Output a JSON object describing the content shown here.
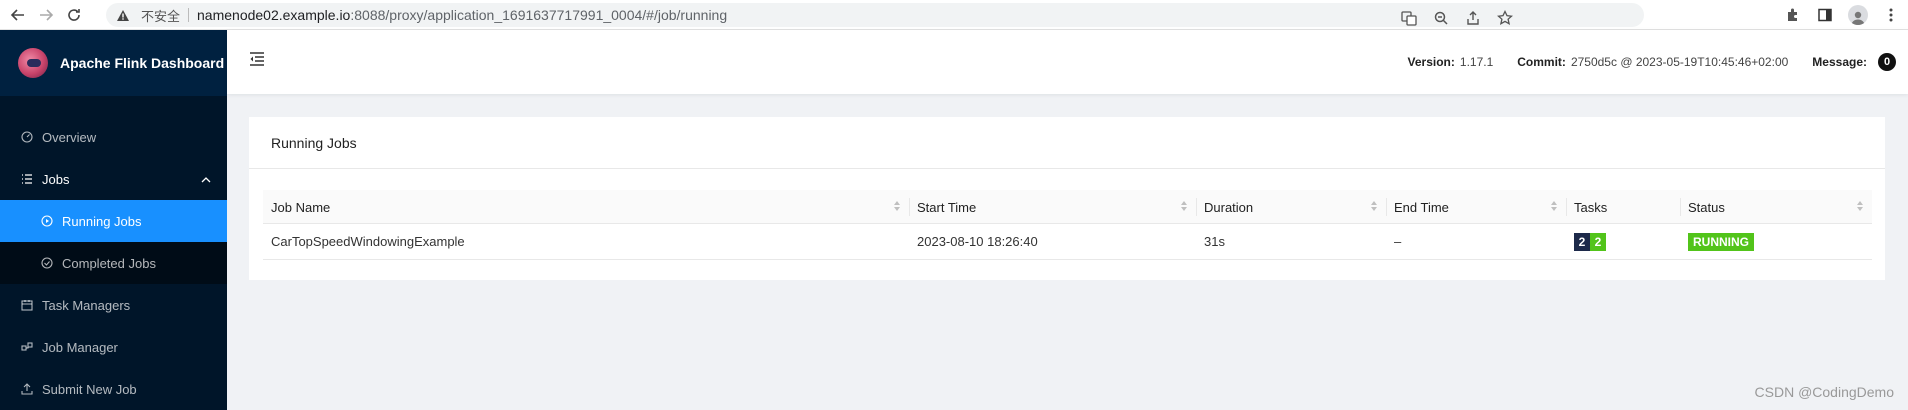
{
  "browser": {
    "insecure_label": "不安全",
    "url_host": "namenode02.example.io",
    "url_rest": ":8088/proxy/application_1691637717991_0004/#/job/running"
  },
  "sidebar": {
    "app_title": "Apache Flink Dashboard",
    "items": [
      {
        "label": "Overview",
        "icon": "dashboard-icon"
      },
      {
        "label": "Jobs",
        "icon": "list-icon"
      },
      {
        "label": "Running Jobs",
        "icon": "play-circle-icon"
      },
      {
        "label": "Completed Jobs",
        "icon": "check-circle-icon"
      },
      {
        "label": "Task Managers",
        "icon": "schedule-icon"
      },
      {
        "label": "Job Manager",
        "icon": "cluster-icon"
      },
      {
        "label": "Submit New Job",
        "icon": "upload-icon"
      }
    ]
  },
  "header": {
    "version_label": "Version:",
    "version_value": "1.17.1",
    "commit_label": "Commit:",
    "commit_value": "2750d5c @ 2023-05-19T10:45:46+02:00",
    "message_label": "Message:",
    "message_count": "0"
  },
  "main": {
    "card_title": "Running Jobs",
    "columns": [
      "Job Name",
      "Start Time",
      "Duration",
      "End Time",
      "Tasks",
      "Status"
    ],
    "rows": [
      {
        "job_name": "CarTopSpeedWindowingExample",
        "start_time": "2023-08-10 18:26:40",
        "duration": "31s",
        "end_time": "–",
        "tasks_total": "2",
        "tasks_running": "2",
        "status": "RUNNING"
      }
    ]
  },
  "colors": {
    "sidebar_bg": "#001529",
    "active_menu": "#1890ff",
    "running_green": "#52c41a",
    "task_total_navy": "#1d2a4a"
  },
  "watermark": "CSDN @CodingDemo"
}
